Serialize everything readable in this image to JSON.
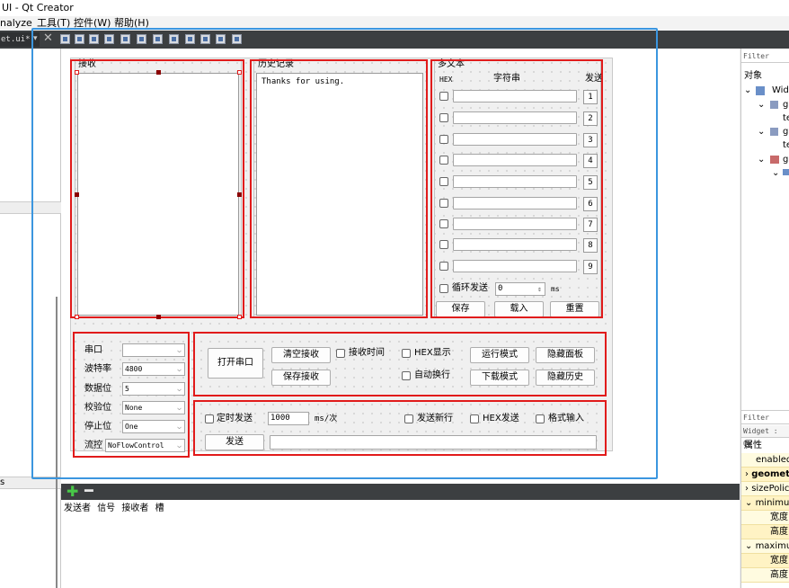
{
  "window": {
    "title": "UI - Qt Creator"
  },
  "menu": {
    "analyze": "nalyze",
    "tools": "工具(T)",
    "controls": "控件(W)",
    "help": "帮助(H)"
  },
  "editor_tab": {
    "label": "et.ui*",
    "close": "✕"
  },
  "left_panel": {
    "section_label": "s"
  },
  "form": {
    "receive": {
      "title": "接收"
    },
    "history": {
      "title": "历史记录",
      "text": "Thanks for using."
    },
    "multitext": {
      "title": "多文本",
      "col_hex": "HEX",
      "col_string": "字符串",
      "col_send": "发送",
      "rows": [
        "1",
        "2",
        "3",
        "4",
        "5",
        "6",
        "7",
        "8",
        "9"
      ],
      "loop_send": "循环发送",
      "loop_value": "0",
      "loop_unit": "ms",
      "save": "保存",
      "load": "载入",
      "reset": "重置"
    },
    "serial": {
      "port_label": "串口",
      "port_value": "",
      "baud_label": "波特率",
      "baud_value": "4800",
      "data_label": "数据位",
      "data_value": "5",
      "parity_label": "校验位",
      "parity_value": "None",
      "stop_label": "停止位",
      "stop_value": "One",
      "flow_label": "流控",
      "flow_value": "NoFlowControl"
    },
    "controls": {
      "open_port": "打开串口",
      "clear_receive": "清空接收",
      "receive_time": "接收时间",
      "hex_display": "HEX显示",
      "run_mode": "运行模式",
      "hide_panel": "隐藏面板",
      "save_receive": "保存接收",
      "auto_wrap": "自动换行",
      "download_mode": "下载模式",
      "hide_history": "隐藏历史"
    },
    "send": {
      "timed_send": "定时发送",
      "interval_value": "1000",
      "interval_unit": "ms/次",
      "send_newline": "发送新行",
      "hex_send": "HEX发送",
      "format_input": "格式输入",
      "send_button": "发送"
    }
  },
  "right_panel": {
    "filter": "Filter",
    "objects": "对象",
    "tree": [
      "Wid",
      "g",
      "te",
      "g",
      "te",
      "g"
    ],
    "filter2": "Filter",
    "widget_line": "Widget : QW",
    "props_header": "属性",
    "props": [
      "enabled",
      "geomet",
      "sizePolic",
      "minimun",
      "宽度",
      "高度",
      "maximun",
      "宽度",
      "高度"
    ]
  },
  "signals_panel": {
    "sender": "发送者",
    "signal": "信号",
    "receiver": "接收者",
    "slot": "槽"
  },
  "colors": {
    "highlight_red": "#e11b1b",
    "selection_blue": "#3b96df",
    "toolbar_dark": "#3c3f41"
  }
}
